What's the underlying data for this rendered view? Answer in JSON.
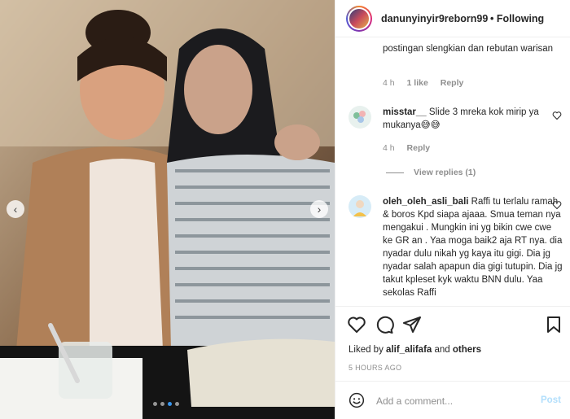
{
  "header": {
    "username": "danunyinyir9reborn99",
    "separator": "•",
    "follow_status": "Following"
  },
  "comments": [
    {
      "text": "postingan slengkian dan rebutan warisan",
      "time": "4 h",
      "likes": "1 like",
      "reply_label": "Reply"
    },
    {
      "username": "misstar__",
      "text": "Slide 3 mreka kok mirip ya mukanya😅😅",
      "time": "4 h",
      "reply_label": "Reply",
      "view_replies": "View replies (1)"
    },
    {
      "username": "oleh_oleh_asli_bali",
      "text": "Raffi tu terlalu ramah & boros Kpd siapa ajaaa. Smua teman nya mengakui . Mungkin ini yg bikin cwe cwe ke GR an . Yaa moga baik2 aja RT nya. dia nyadar dulu nikah yg kaya itu gigi. Dia jg nyadar salah apapun dia gigi tutupin. Dia jg takut kpleset kyk waktu BNN dulu. Yaa sekolas Raffi"
    }
  ],
  "actions": {
    "liked_prefix": "Liked by",
    "liked_user": "alif_alifafa",
    "liked_and": "and",
    "liked_others": "others",
    "timestamp": "5 HOURS AGO"
  },
  "add_comment": {
    "placeholder": "Add a comment...",
    "post_label": "Post"
  },
  "carousel": {
    "slide_count": 4,
    "active_slide": 3,
    "prev_icon": "chevron-left-icon",
    "next_icon": "chevron-right-icon"
  },
  "colors": {
    "link_blue": "#3897f0",
    "post_disabled": "#b2dffc",
    "meta_gray": "#8e8e8e"
  }
}
